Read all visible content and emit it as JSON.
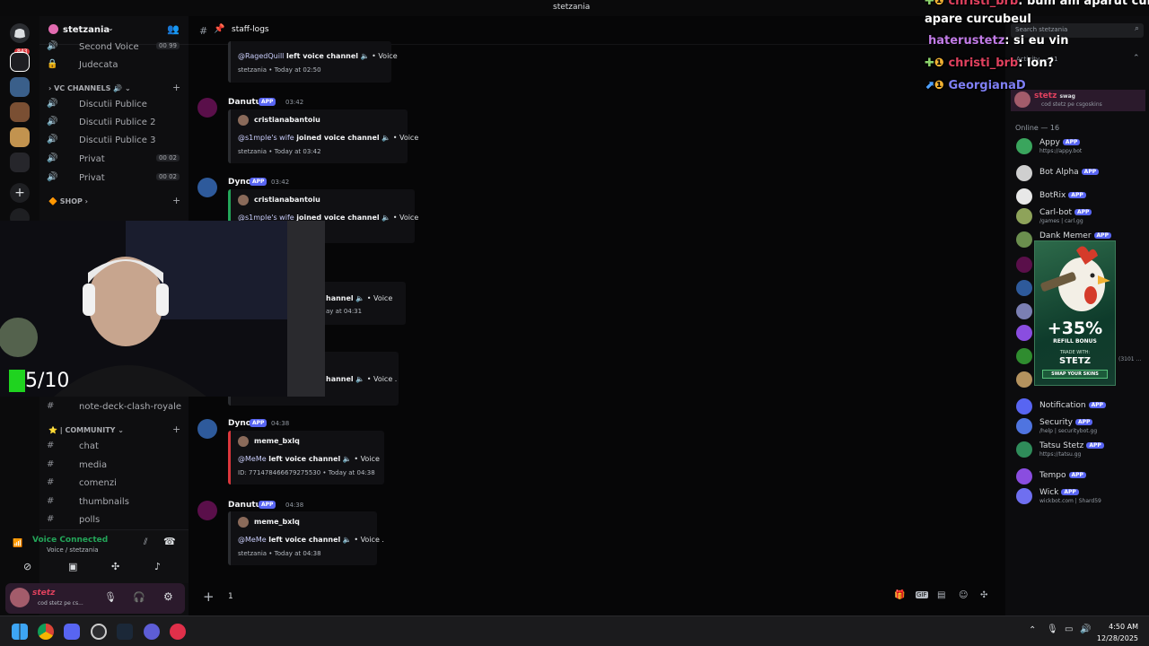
{
  "window": {
    "title": "stetzania"
  },
  "servers": {
    "badge": "843"
  },
  "guild": {
    "name": "stetzania",
    "top_channels": [
      {
        "label": "Second Voice",
        "count": "00 99"
      },
      {
        "label": "Judecata"
      }
    ],
    "vc_category": "VC CHANNELS",
    "vc_channels": [
      {
        "label": "Discutii Publice"
      },
      {
        "label": "Discutii Publice 2"
      },
      {
        "label": "Discutii Publice 3"
      },
      {
        "label": "Privat",
        "count": "00 02"
      },
      {
        "label": "Privat",
        "count": "00 02"
      }
    ],
    "shop_category": "SHOP",
    "note_channel": "note-deck-clash-royale",
    "community_category": "| COMMUNITY",
    "community_channels": [
      {
        "label": "chat"
      },
      {
        "label": "media"
      },
      {
        "label": "comenzi"
      },
      {
        "label": "thumbnails"
      },
      {
        "label": "polls"
      }
    ]
  },
  "voice": {
    "status": "Voice Connected",
    "location": "Voice / stetzania"
  },
  "user": {
    "name": "stetz",
    "status": "cod stetz pe cs..."
  },
  "chat": {
    "channel": "staff-logs",
    "messages": [
      {
        "author": "",
        "time": "",
        "embed_user": "",
        "desc_mention": "@RagedQuill",
        "desc_action": "left voice channel",
        "desc_target": "• Voice",
        "footer": "stetzania • Today at 02:50"
      },
      {
        "author": "Danutu",
        "tag": "APP",
        "time": "03:42",
        "embed_user": "cristianabantoiu",
        "desc_mention": "@s1mple's wife",
        "desc_action": "joined voice channel",
        "desc_target": "• Voice",
        "footer": "stetzania • Today at 03:42"
      },
      {
        "author": "Dyno",
        "tag": "APP",
        "time": "03:42",
        "embed_user": "cristianabantoiu",
        "desc_mention": "@s1mple's wife",
        "desc_action": "joined voice channel",
        "desc_target": "• Voice",
        "footer": "stetzania • Today at 03:42"
      },
      {
        "author": "",
        "time": "",
        "embed_user": "",
        "desc_mention": "",
        "desc_action": "hannel",
        "desc_target": "• Voice",
        "footer": "ay at 04:31"
      },
      {
        "author": "",
        "time": "",
        "embed_user": "",
        "desc_mention": "",
        "desc_action": "hannel",
        "desc_target": "• Voice .",
        "footer": ""
      },
      {
        "author": "Dyno",
        "tag": "APP",
        "time": "04:38",
        "embed_user": "meme_bxlq",
        "desc_mention": "@MeMe",
        "desc_action": "left voice channel",
        "desc_target": "• Voice",
        "footer": "ID: 771478466679275530 • Today at 04:38"
      },
      {
        "author": "Danutu",
        "tag": "APP",
        "time": "04:38",
        "embed_user": "meme_bxlq",
        "desc_mention": "@MeMe",
        "desc_action": "left voice channel",
        "desc_target": "• Voice .",
        "footer": "stetzania • Today at 04:38"
      }
    ],
    "composer_value": "1"
  },
  "members": {
    "search_placeholder": "Search stetzania",
    "activity_label": "Activity — 11",
    "pinned_user": {
      "name": "stetz",
      "badge": "swag",
      "status": "cod stetz pe csgoskins"
    },
    "online_header": "Online — 16",
    "list": [
      {
        "name": "Appy",
        "tag": "APP",
        "sub": "https://appy.bot",
        "color": "#3aa55d"
      },
      {
        "name": "Bot Alpha",
        "tag": "APP",
        "sub": "",
        "color": "#cfcfcf"
      },
      {
        "name": "BotRix",
        "tag": "APP",
        "sub": "",
        "color": "#e8e8e8"
      },
      {
        "name": "Carl-bot",
        "tag": "APP",
        "sub": "/games | carl.gg",
        "color": "#8ea35a"
      },
      {
        "name": "Dank Memer",
        "tag": "APP",
        "sub": "",
        "color": "#6b8e4e"
      },
      {
        "name": "Notification",
        "tag": "APP",
        "sub": "",
        "color": "#5865f2"
      },
      {
        "name": "Security",
        "tag": "APP",
        "sub": "/help | securitybot.gg",
        "color": "#4f74e0"
      },
      {
        "name": "Tatsu Stetz",
        "tag": "APP",
        "sub": "https://tatsu.gg",
        "color": "#2f8c5a"
      },
      {
        "name": "Tempo",
        "tag": "APP",
        "sub": "",
        "color": "#8a4de0"
      },
      {
        "name": "Wick",
        "tag": "APP",
        "sub": "wickbot.com | Shard59",
        "color": "#6f6ff0"
      }
    ],
    "partial_sub": "(3101 ..."
  },
  "ad": {
    "headline": "+35%",
    "subline": "REFILL BONUS",
    "trade_with": "TRADE WITH:",
    "code": "STETZ",
    "cta": "SWAP YOUR SKINS"
  },
  "stream_overlay": {
    "lines": [
      {
        "user": "christi_brb",
        "text": ": bum am aparut cum"
      },
      {
        "user": "",
        "text": "apare curcubeul"
      },
      {
        "user": "haterustetz",
        "text": ": si eu vin"
      },
      {
        "user": "christi_brb",
        "text": ": lon?"
      },
      {
        "user": "GeorgianaD",
        "text": ""
      }
    ],
    "score": "5/10"
  },
  "taskbar": {
    "time": "4:50 AM",
    "date": "12/28/2025"
  },
  "colors": {
    "blurple": "#5865f2",
    "online": "#23a559",
    "overlay_red": "#e0415e"
  }
}
